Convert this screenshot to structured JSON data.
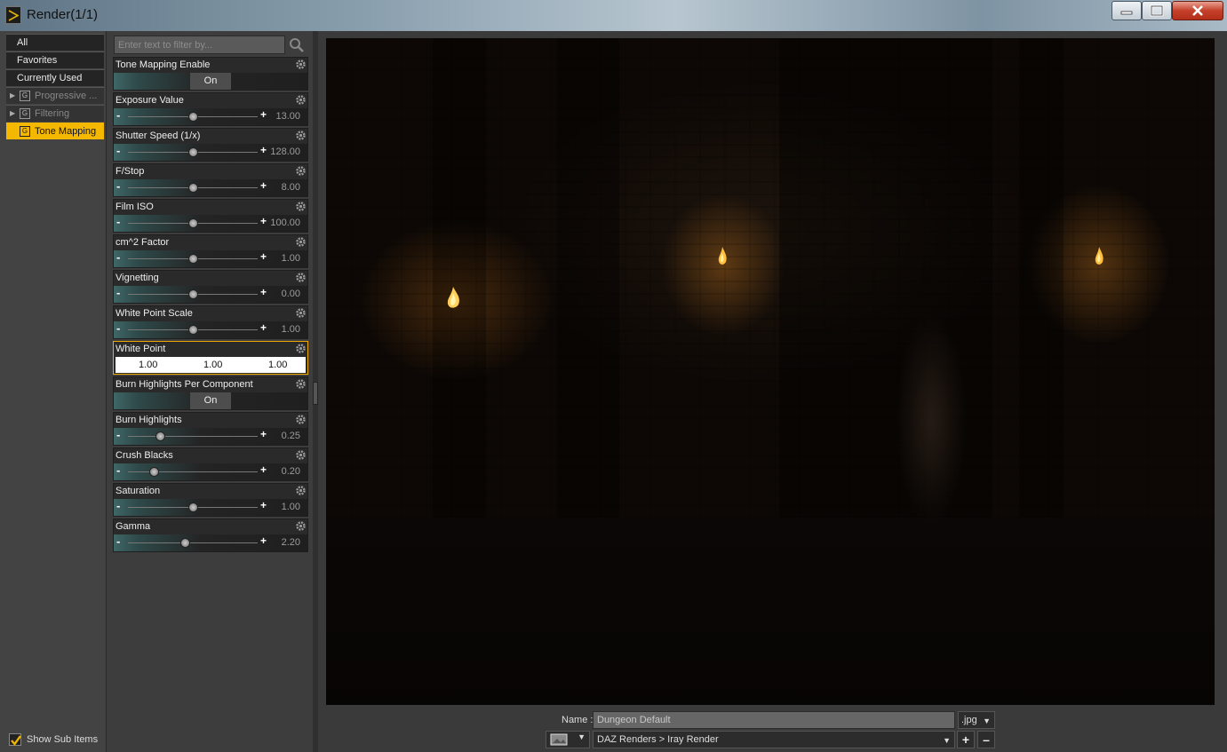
{
  "window": {
    "title": "Render(1/1)"
  },
  "categories": [
    {
      "label": "All"
    },
    {
      "label": "Favorites"
    },
    {
      "label": "Currently Used"
    }
  ],
  "groups": [
    {
      "label": "Progressive ...",
      "badge": "G",
      "state": "collapsed"
    },
    {
      "label": "Filtering",
      "badge": "G",
      "state": "collapsed"
    },
    {
      "label": "Tone Mapping",
      "badge": "G",
      "state": "selected"
    }
  ],
  "filter": {
    "placeholder": "Enter text to filter by..."
  },
  "properties": [
    {
      "label": "Tone Mapping Enable",
      "kind": "toggle",
      "value": "On"
    },
    {
      "label": "Exposure Value",
      "kind": "slider",
      "value": "13.00",
      "fraction": 0.5
    },
    {
      "label": "Shutter Speed (1/x)",
      "kind": "slider",
      "value": "128.00",
      "fraction": 0.5
    },
    {
      "label": "F/Stop",
      "kind": "slider",
      "value": "8.00",
      "fraction": 0.5
    },
    {
      "label": "Film ISO",
      "kind": "slider",
      "value": "100.00",
      "fraction": 0.5
    },
    {
      "label": "cm^2 Factor",
      "kind": "slider",
      "value": "1.00",
      "fraction": 0.5
    },
    {
      "label": "Vignetting",
      "kind": "slider",
      "value": "0.00",
      "fraction": 0.5
    },
    {
      "label": "White Point Scale",
      "kind": "slider",
      "value": "1.00",
      "fraction": 0.5
    },
    {
      "label": "White Point",
      "kind": "color",
      "values": [
        "1.00",
        "1.00",
        "1.00"
      ]
    },
    {
      "label": "Burn Highlights Per Component",
      "kind": "toggle",
      "value": "On"
    },
    {
      "label": "Burn Highlights",
      "kind": "slider",
      "value": "0.25",
      "fraction": 0.25
    },
    {
      "label": "Crush Blacks",
      "kind": "slider",
      "value": "0.20",
      "fraction": 0.2
    },
    {
      "label": "Saturation",
      "kind": "slider",
      "value": "1.00",
      "fraction": 0.5
    },
    {
      "label": "Gamma",
      "kind": "slider",
      "value": "2.20",
      "fraction": 0.44
    }
  ],
  "show_sub_items": {
    "label": "Show Sub Items",
    "checked": true
  },
  "output": {
    "name_label": "Name :",
    "name_value": "Dungeon Default",
    "extension": ".jpg",
    "path": "DAZ Renders > Iray Render"
  },
  "icons": {
    "app": "daz-studio-icon",
    "search": "search-icon",
    "gear": "gear-icon",
    "image": "image-icon"
  },
  "colors": {
    "selection": "#f5b800",
    "slider_accent": "#3f6666",
    "close_button": "#c4402a"
  }
}
